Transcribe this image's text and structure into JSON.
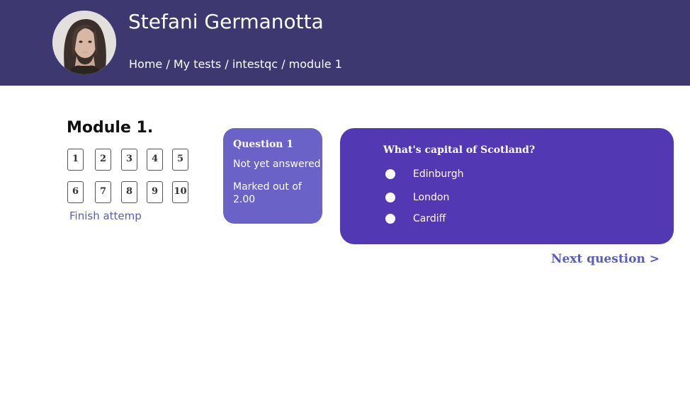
{
  "header": {
    "user_name": "Stefani Germanotta",
    "avatar_icon": "user-photo",
    "breadcrumb": [
      {
        "label": "Home"
      },
      {
        "label": "My tests"
      },
      {
        "label": "intestqc"
      },
      {
        "label": "module 1"
      }
    ],
    "breadcrumb_separator": "/"
  },
  "nav": {
    "module_title": "Module 1.",
    "questions": [
      "1",
      "2",
      "3",
      "4",
      "5",
      "6",
      "7",
      "8",
      "9",
      "10"
    ],
    "finish_label": "Finish attemp"
  },
  "question_info": {
    "number_label": "Question 1",
    "state": "Not yet answered",
    "grade": "Marked out of 2.00"
  },
  "question": {
    "text": "What's capital of Scotland?",
    "answers": [
      {
        "label": "Edinburgh"
      },
      {
        "label": "London"
      },
      {
        "label": "Cardiff"
      }
    ]
  },
  "next_label": "Next question >",
  "colors": {
    "header_bg": "#3d3870",
    "info_card_bg": "#6b62c8",
    "question_card_bg": "#5239b3",
    "link": "#5b5bb8"
  }
}
